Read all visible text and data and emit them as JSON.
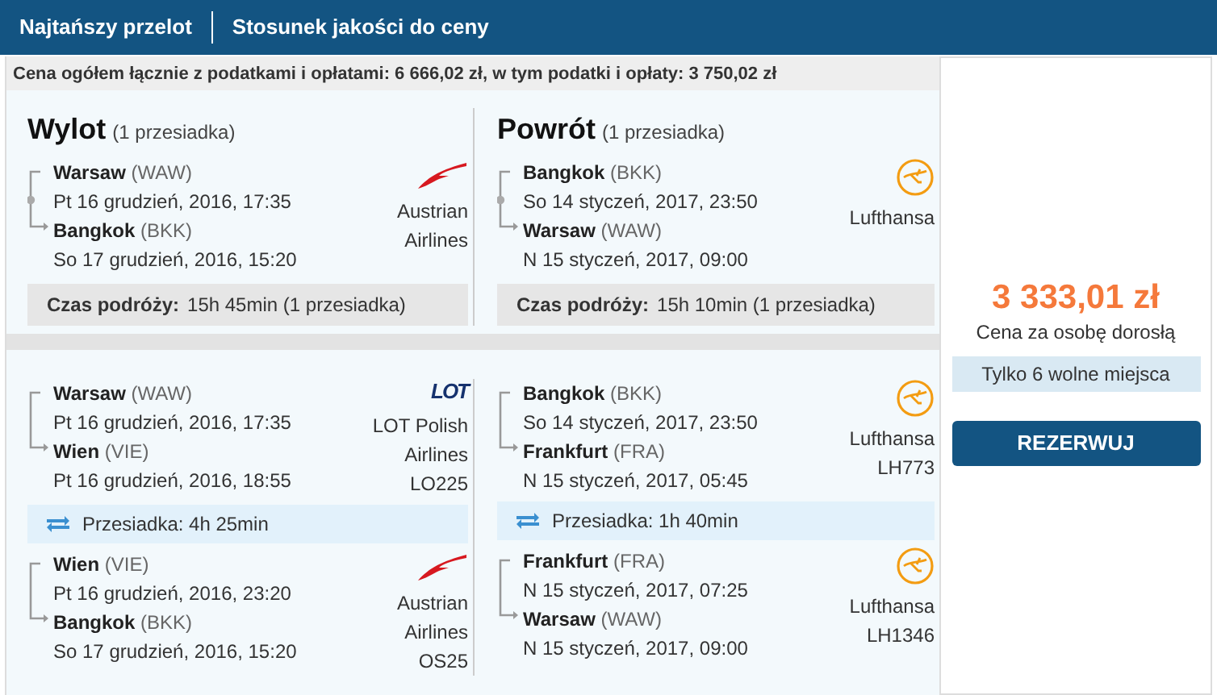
{
  "tabs": [
    {
      "label": "Najtańszy przelot"
    },
    {
      "label": "Stosunek jakości do ceny"
    }
  ],
  "price_summary": "Cena ogółem łącznie z podatkami i opłatami: 6 666,02 zł, w tym podatki i opłaty: 3 750,02 zł",
  "summary": [
    {
      "title": "Wylot",
      "stops": "(1 przesiadka)",
      "legs": {
        "from": {
          "city": "Warsaw",
          "code": "(WAW)",
          "datetime": "Pt 16 grudzień, 2016, 17:35"
        },
        "to": {
          "city": "Bangkok",
          "code": "(BKK)",
          "datetime": "So 17 grudzień, 2016, 15:20"
        },
        "via_stop": true
      },
      "airline": {
        "kind": "austrian",
        "name": "Austrian Airlines"
      },
      "duration_label": "Czas podróży:",
      "duration": "15h 45min (1 przesiadka)"
    },
    {
      "title": "Powrót",
      "stops": "(1 przesiadka)",
      "legs": {
        "from": {
          "city": "Bangkok",
          "code": "(BKK)",
          "datetime": "So 14 styczeń, 2017, 23:50"
        },
        "to": {
          "city": "Warsaw",
          "code": "(WAW)",
          "datetime": "N 15 styczeń, 2017, 09:00"
        },
        "via_stop": true
      },
      "airline": {
        "kind": "lufthansa",
        "name": "Lufthansa"
      },
      "duration_label": "Czas podróży:",
      "duration": "15h 10min (1 przesiadka)"
    }
  ],
  "details": [
    {
      "segments": [
        {
          "from": {
            "city": "Warsaw",
            "code": "(WAW)",
            "datetime": "Pt 16 grudzień, 2016, 17:35"
          },
          "to": {
            "city": "Wien",
            "code": "(VIE)",
            "datetime": "Pt 16 grudzień, 2016, 18:55"
          },
          "airline": {
            "kind": "lot",
            "logo_text": "LOT",
            "name": "LOT Polish Airlines",
            "flight": "LO225"
          }
        },
        {
          "from": {
            "city": "Wien",
            "code": "(VIE)",
            "datetime": "Pt 16 grudzień, 2016, 23:20"
          },
          "to": {
            "city": "Bangkok",
            "code": "(BKK)",
            "datetime": "So 17 grudzień, 2016, 15:20"
          },
          "airline": {
            "kind": "austrian",
            "name": "Austrian Airlines",
            "flight": "OS25"
          }
        }
      ],
      "layovers": [
        "Przesiadka: 4h 25min"
      ]
    },
    {
      "segments": [
        {
          "from": {
            "city": "Bangkok",
            "code": "(BKK)",
            "datetime": "So 14 styczeń, 2017, 23:50"
          },
          "to": {
            "city": "Frankfurt",
            "code": "(FRA)",
            "datetime": "N 15 styczeń, 2017, 05:45"
          },
          "airline": {
            "kind": "lufthansa",
            "name": "Lufthansa",
            "flight": "LH773"
          }
        },
        {
          "from": {
            "city": "Frankfurt",
            "code": "(FRA)",
            "datetime": "N 15 styczeń, 2017, 07:25"
          },
          "to": {
            "city": "Warsaw",
            "code": "(WAW)",
            "datetime": "N 15 styczeń, 2017, 09:00"
          },
          "airline": {
            "kind": "lufthansa",
            "name": "Lufthansa",
            "flight": "LH1346"
          }
        }
      ],
      "layovers": [
        "Przesiadka: 1h 40min"
      ]
    }
  ],
  "offer": {
    "price": "3 333,01 zł",
    "price_note": "Cena za osobę dorosłą",
    "seats": "Tylko 6 wolne miejsca",
    "button": "REZERWUJ"
  }
}
